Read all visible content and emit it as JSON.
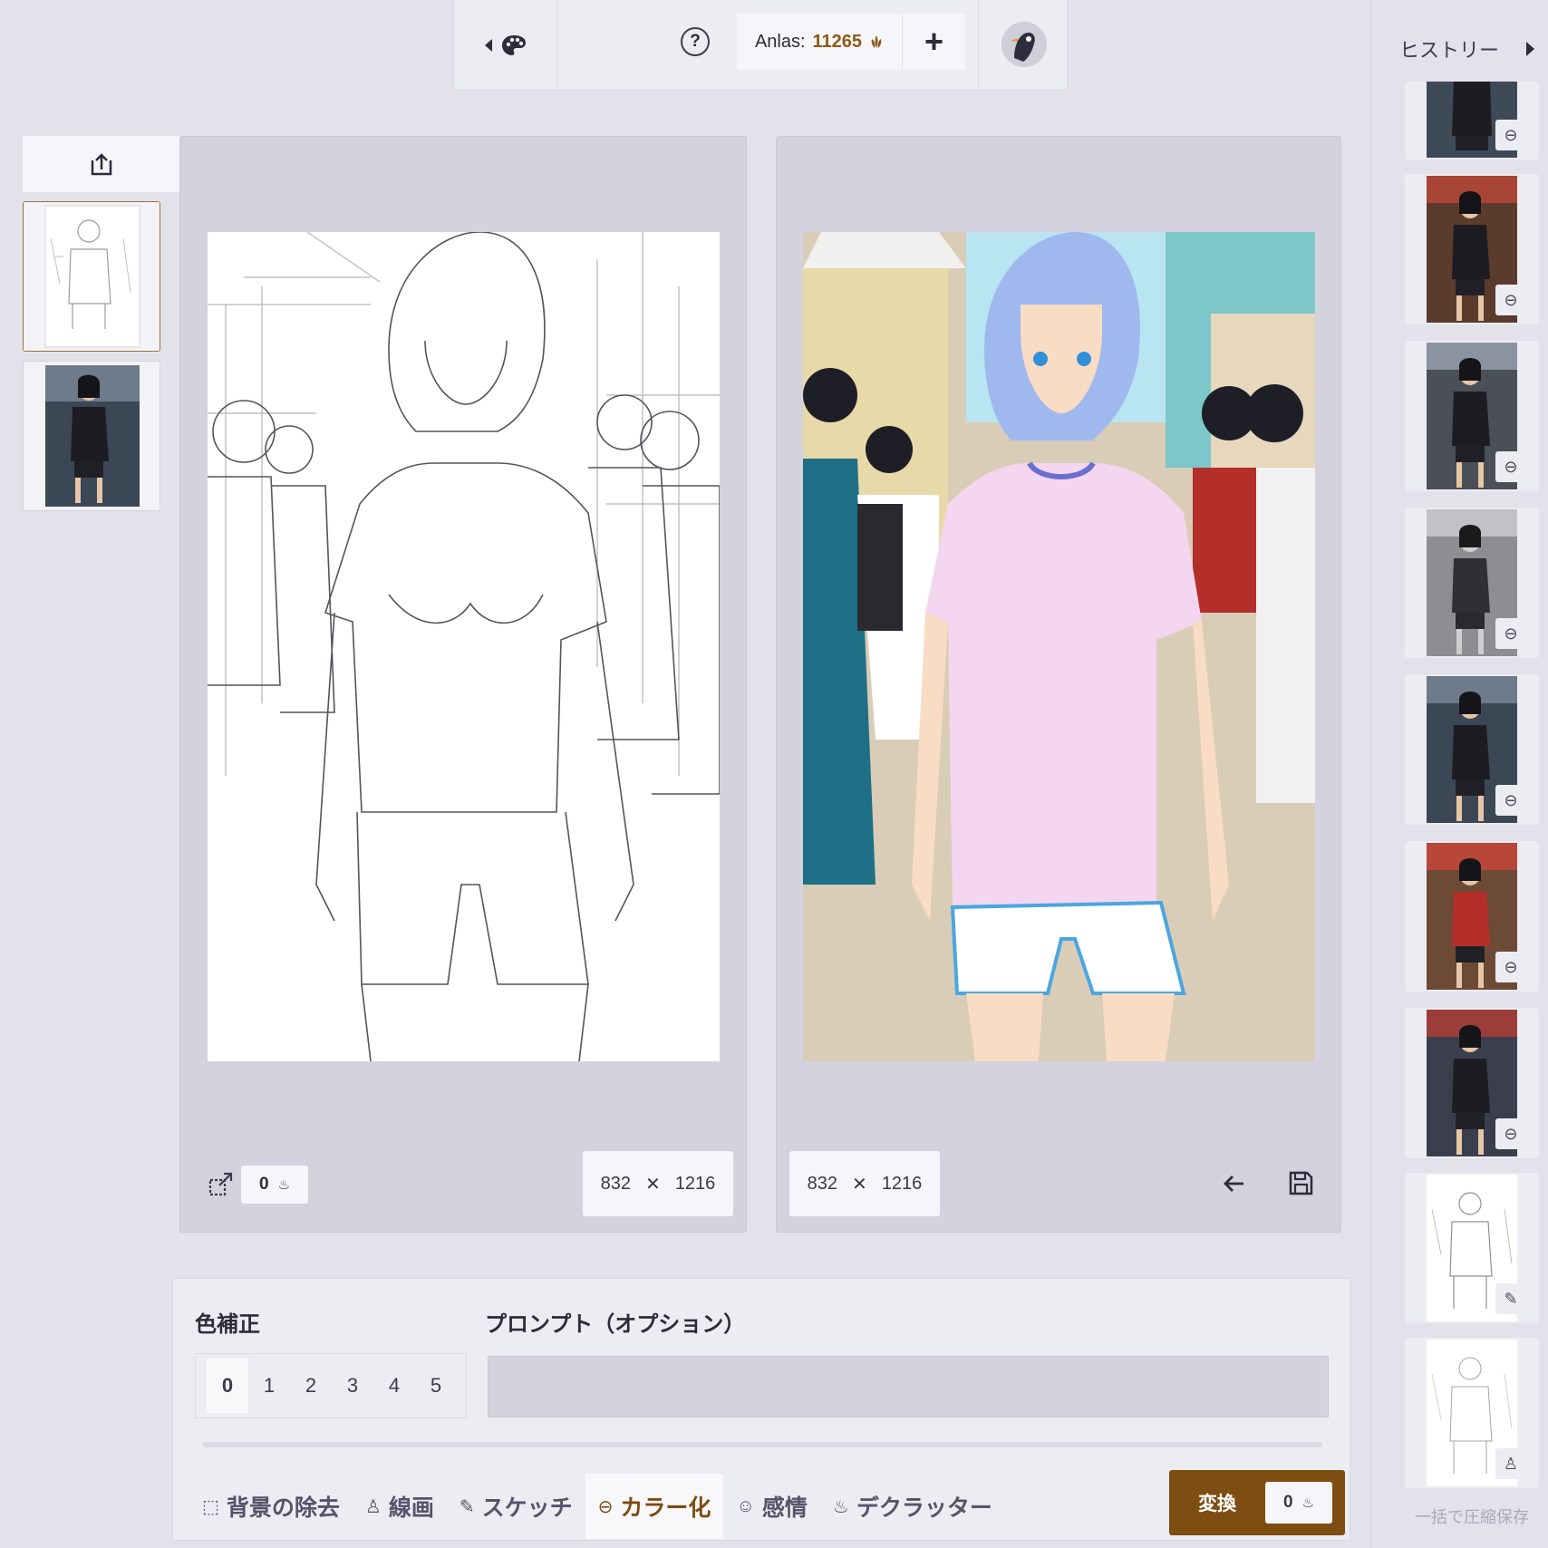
{
  "topbar": {
    "anlas_label": "Anlas:",
    "anlas_value": "11265",
    "plus": "+"
  },
  "source_panel": {
    "cost": "0",
    "width": "832",
    "height": "1216",
    "times": "✕"
  },
  "result_panel": {
    "width": "832",
    "height": "1216",
    "times": "✕"
  },
  "controls": {
    "color_correction_title": "色補正",
    "color_levels": [
      "0",
      "1",
      "2",
      "3",
      "4",
      "5"
    ],
    "selected_level": "0",
    "prompt_title": "プロンプト（オプション）",
    "prompt_value": "",
    "tools": [
      {
        "label": "背景の除去",
        "icon": "background-removal-icon"
      },
      {
        "label": "線画",
        "icon": "lineart-icon"
      },
      {
        "label": "スケッチ",
        "icon": "sketch-icon"
      },
      {
        "label": "カラー化",
        "icon": "colorize-icon"
      },
      {
        "label": "感情",
        "icon": "emotion-icon"
      },
      {
        "label": "デクラッター",
        "icon": "declutter-icon"
      }
    ],
    "active_tool": "カラー化",
    "convert_label": "変換",
    "convert_cost": "0"
  },
  "history": {
    "title": "ヒストリー",
    "bulk_save": "一括で圧縮保存"
  },
  "colors": {
    "accent": "#7e4d12",
    "anlas": "#8c5b16",
    "background": "#e3e2ea",
    "panel": "#d3d2de"
  }
}
